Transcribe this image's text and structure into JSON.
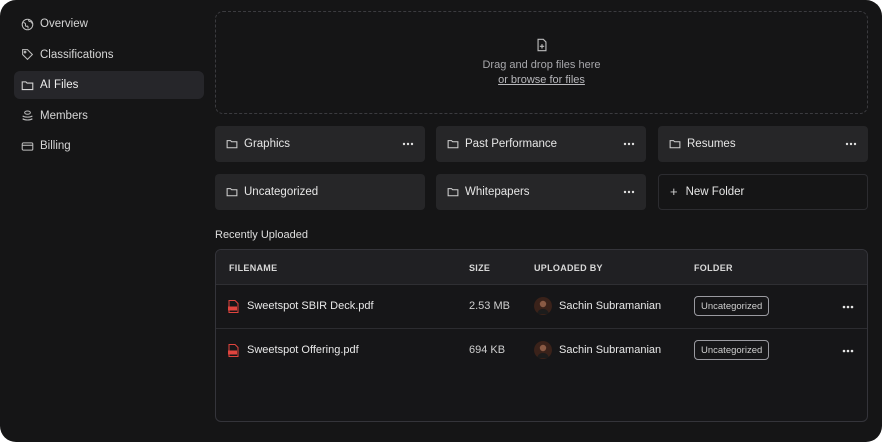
{
  "sidebar": {
    "items": [
      {
        "label": "Overview",
        "icon": "globe-icon",
        "active": false
      },
      {
        "label": "Classifications",
        "icon": "tag-icon",
        "active": false
      },
      {
        "label": "AI Files",
        "icon": "folder-icon",
        "active": true
      },
      {
        "label": "Members",
        "icon": "users-icon",
        "active": false
      },
      {
        "label": "Billing",
        "icon": "credit-card-icon",
        "active": false
      }
    ]
  },
  "dropzone": {
    "icon": "file-plus-icon",
    "text": "Drag and drop files here",
    "link": "or browse for files"
  },
  "folders": [
    {
      "label": "Graphics"
    },
    {
      "label": "Past Performance"
    },
    {
      "label": "Resumes"
    },
    {
      "label": "Uncategorized"
    },
    {
      "label": "Whitepapers"
    }
  ],
  "new_folder_label": "New Folder",
  "recent": {
    "title": "Recently Uploaded",
    "columns": [
      "FILENAME",
      "SIZE",
      "UPLOADED BY",
      "FOLDER"
    ],
    "rows": [
      {
        "filename": "Sweetspot SBIR Deck.pdf",
        "size": "2.53 MB",
        "uploaded_by": "Sachin Subramanian",
        "folder": "Uncategorized"
      },
      {
        "filename": "Sweetspot Offering.pdf",
        "size": "694 KB",
        "uploaded_by": "Sachin Subramanian",
        "folder": "Uncategorized"
      }
    ]
  },
  "colors": {
    "background": "#151516",
    "panel": "#262628",
    "pdf_icon": "#e0443e"
  }
}
